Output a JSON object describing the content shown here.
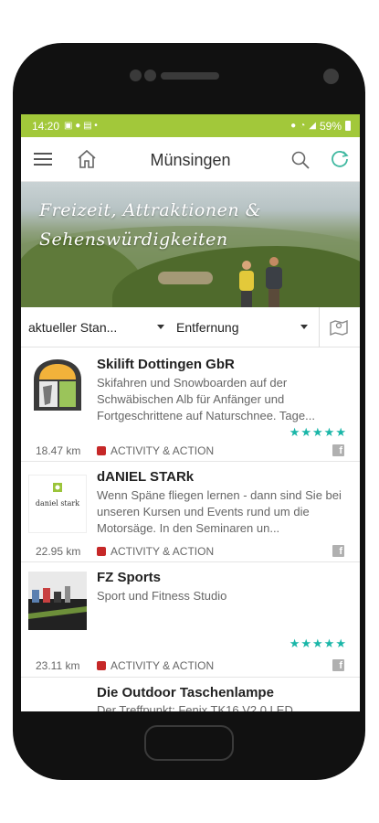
{
  "status_bar": {
    "time": "14:20",
    "battery": "59%"
  },
  "app_bar": {
    "title": "Münsingen"
  },
  "banner": {
    "line1": "Freizeit, Attraktionen &",
    "line2": "Sehenswürdigkeiten"
  },
  "filters": {
    "location": "aktueller Stan...",
    "sort": "Entfernung"
  },
  "listings": [
    {
      "name": "Skilift Dottingen GbR",
      "description": "Skifahren und Snowboarden auf der Schwäbischen Alb für Anfänger und Fortgeschrittene auf Naturschnee. Tage...",
      "rating": "★★★★★",
      "distance": "18.47 km",
      "category": "ACTIVITY & ACTION"
    },
    {
      "name": "dANIEL STARk",
      "description": "Wenn Späne fliegen lernen - dann sind Sie bei unseren Kursen und Events rund um die Motorsäge. In den Seminaren un...",
      "thumb_text": "daniel stark",
      "distance": "22.95 km",
      "category": "ACTIVITY & ACTION"
    },
    {
      "name": "FZ Sports",
      "description": "Sport und Fitness Studio",
      "rating": "★★★★★",
      "distance": "23.11 km",
      "category": "ACTIVITY & ACTION"
    },
    {
      "name": "Die Outdoor Taschenlampe",
      "description": "Der Treffpunkt: Fenix TK16 V2.0 LED"
    }
  ],
  "colors": {
    "status_bar": "#a2c83a",
    "stars": "#1ab6a8",
    "category_marker": "#c62828"
  }
}
